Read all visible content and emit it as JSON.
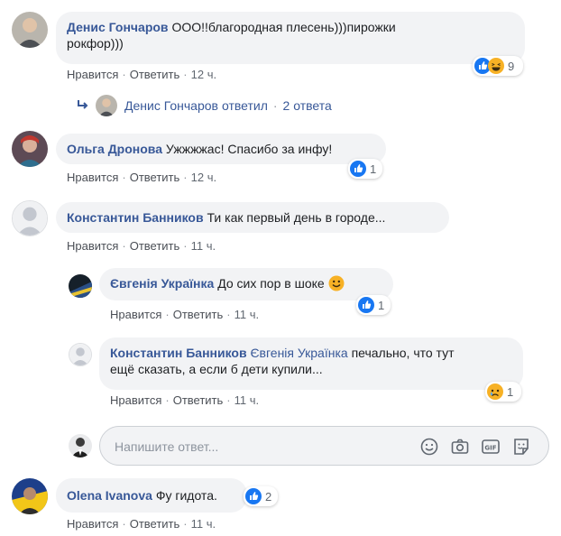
{
  "actions": {
    "like": "Нравится",
    "reply": "Ответить",
    "sep": "·"
  },
  "comments": [
    {
      "author": "Денис Гончаров",
      "text_line1": "ООО!!благородная плесень)))пирожки",
      "text_line2": "рокфор)))",
      "time": "12 ч.",
      "reactions": {
        "icons": [
          "like-icon",
          "haha-icon"
        ],
        "count": "9"
      },
      "replies_summary": {
        "author": "Денис Гончаров",
        "verb": "ответил",
        "sep": "·",
        "count_label": "2 ответа"
      }
    },
    {
      "author": "Ольга Дронова",
      "text": "Ужжжжас! Спасибо за инфу!",
      "time": "12 ч.",
      "reactions": {
        "icons": [
          "like-icon"
        ],
        "count": "1"
      }
    },
    {
      "author": "Константин Банников",
      "text": "Ти как первый день в городе...",
      "time": "11 ч.",
      "replies": [
        {
          "author": "Євгенія Українка",
          "text": "До сих пор в шоке",
          "emoji": "smile-emoji",
          "time": "11 ч.",
          "reactions": {
            "icons": [
              "like-icon"
            ],
            "count": "1"
          }
        },
        {
          "author": "Константин Банников",
          "mention": "Євгенія Українка",
          "text_line1": "печально, что тут",
          "text_line2": "ещё сказать, а если б дети купили...",
          "time": "11 ч.",
          "reactions": {
            "icons": [
              "sad-icon"
            ],
            "count": "1"
          }
        }
      ]
    },
    {
      "author": "Olena Ivanova",
      "text": "Фу гидота.",
      "time": "11 ч.",
      "reactions": {
        "icons": [
          "like-icon"
        ],
        "count": "2"
      }
    }
  ],
  "composer": {
    "placeholder": "Напишите ответ...",
    "icons": [
      "emoji-icon",
      "camera-icon",
      "gif-icon",
      "sticker-icon"
    ]
  },
  "colors": {
    "link": "#385898",
    "bubble": "#f2f3f5",
    "like_blue": "#1877f2",
    "emoji_yellow": "#f7b125"
  }
}
